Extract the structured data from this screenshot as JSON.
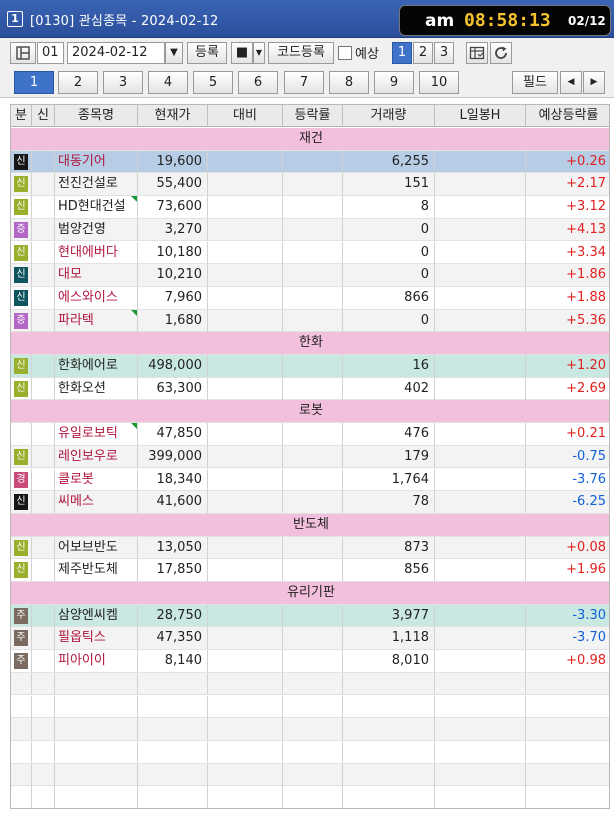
{
  "window": {
    "number": "1",
    "title": "[0130] 관심종목 - 2024-02-12",
    "clock": {
      "ampm": "am",
      "time": "08:58:13",
      "date": "02/12"
    }
  },
  "toolbar": {
    "group_no": "01",
    "date": "2024-02-12",
    "register": "등록",
    "square": "■",
    "code_register": "코드등록",
    "expect_label": "예상",
    "views": [
      "1",
      "2",
      "3"
    ]
  },
  "pages": {
    "tabs": [
      "1",
      "2",
      "3",
      "4",
      "5",
      "6",
      "7",
      "8",
      "9",
      "10"
    ],
    "field": "필드"
  },
  "columns": [
    "분",
    "신",
    "종목명",
    "현재가",
    "대비",
    "등락률",
    "거래량",
    "L일봉H",
    "예상등락률"
  ],
  "rows": [
    {
      "type": "group",
      "title": "재건"
    },
    {
      "badge": "신",
      "bc": "b-black",
      "name": "대동기어",
      "red": true,
      "price": "19,600",
      "volume": "6,255",
      "exp": "+0.26",
      "dir": "pos",
      "hl": "sel"
    },
    {
      "badge": "신",
      "bc": "b-green",
      "name": "전진건설로",
      "price": "55,400",
      "volume": "151",
      "exp": "+2.17",
      "dir": "pos"
    },
    {
      "badge": "신",
      "bc": "b-green",
      "name": "HD현대건설",
      "price": "73,600",
      "volume": "8",
      "exp": "+3.12",
      "dir": "pos",
      "tri": true
    },
    {
      "badge": "증",
      "bc": "b-purple",
      "name": "범양건영",
      "price": "3,270",
      "volume": "0",
      "exp": "+4.13",
      "dir": "pos"
    },
    {
      "badge": "신",
      "bc": "b-green",
      "name": "현대에버다",
      "red": true,
      "price": "10,180",
      "volume": "0",
      "exp": "+3.34",
      "dir": "pos"
    },
    {
      "badge": "신",
      "bc": "b-teal",
      "name": "대모",
      "red": true,
      "price": "10,210",
      "volume": "0",
      "exp": "+1.86",
      "dir": "pos"
    },
    {
      "badge": "신",
      "bc": "b-teal",
      "name": "에스와이스",
      "red": true,
      "price": "7,960",
      "volume": "866",
      "exp": "+1.88",
      "dir": "pos"
    },
    {
      "badge": "증",
      "bc": "b-purple",
      "name": "파라텍",
      "red": true,
      "price": "1,680",
      "volume": "0",
      "exp": "+5.36",
      "dir": "pos",
      "tri": true
    },
    {
      "type": "group",
      "title": "한화"
    },
    {
      "badge": "신",
      "bc": "b-green",
      "name": "한화에어로",
      "price": "498,000",
      "volume": "16",
      "exp": "+1.20",
      "dir": "pos",
      "hl": "mint"
    },
    {
      "badge": "신",
      "bc": "b-green",
      "name": "한화오션",
      "price": "63,300",
      "volume": "402",
      "exp": "+2.69",
      "dir": "pos"
    },
    {
      "type": "group",
      "title": "로봇"
    },
    {
      "badge": "",
      "bc": "",
      "name": "유일로보틱",
      "red": true,
      "price": "47,850",
      "volume": "476",
      "exp": "+0.21",
      "dir": "pos",
      "tri": true
    },
    {
      "badge": "신",
      "bc": "b-green",
      "name": "레인보우로",
      "red": true,
      "price": "399,000",
      "volume": "179",
      "exp": "-0.75",
      "dir": "neg"
    },
    {
      "badge": "경",
      "bc": "b-pink",
      "name": "클로봇",
      "red": true,
      "price": "18,340",
      "volume": "1,764",
      "exp": "-3.76",
      "dir": "neg"
    },
    {
      "badge": "신",
      "bc": "b-black",
      "name": "씨메스",
      "red": true,
      "price": "41,600",
      "volume": "78",
      "exp": "-6.25",
      "dir": "neg"
    },
    {
      "type": "group",
      "title": "반도체"
    },
    {
      "badge": "신",
      "bc": "b-green",
      "name": "어보브반도",
      "price": "13,050",
      "volume": "873",
      "exp": "+0.08",
      "dir": "pos"
    },
    {
      "badge": "신",
      "bc": "b-green",
      "name": "제주반도체",
      "price": "17,850",
      "volume": "856",
      "exp": "+1.96",
      "dir": "pos"
    },
    {
      "type": "group",
      "title": "유리기판"
    },
    {
      "badge": "주",
      "bc": "b-brown",
      "name": "삼양엔씨켐",
      "price": "28,750",
      "volume": "3,977",
      "exp": "-3.30",
      "dir": "neg",
      "hl": "mint"
    },
    {
      "badge": "주",
      "bc": "b-brown",
      "name": "필옵틱스",
      "red": true,
      "price": "47,350",
      "volume": "1,118",
      "exp": "-3.70",
      "dir": "neg"
    },
    {
      "badge": "주",
      "bc": "b-brown",
      "name": "피아이이",
      "red": true,
      "price": "8,140",
      "volume": "8,010",
      "exp": "+0.98",
      "dir": "pos"
    }
  ]
}
